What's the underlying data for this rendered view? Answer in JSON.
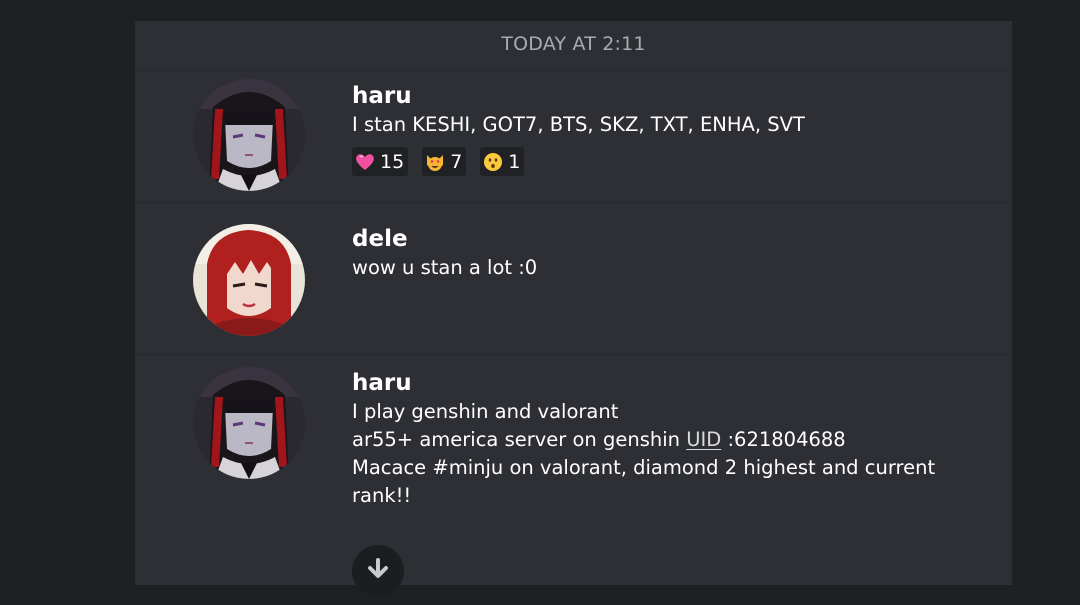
{
  "timestamp": "TODAY AT 2:11",
  "messages": [
    {
      "username": "haru",
      "lines": [
        "I stan KESHI, GOT7, BTS, SKZ, TXT, ENHA, SVT"
      ],
      "reactions": [
        {
          "icon": "pink-heart-icon",
          "count": "15"
        },
        {
          "icon": "heart-eyes-cat-icon",
          "count": "7"
        },
        {
          "icon": "kissing-face-icon",
          "count": "1"
        }
      ]
    },
    {
      "username": "dele",
      "lines": [
        "wow u stan a lot :0"
      ]
    },
    {
      "username": "haru",
      "lines": [
        "I play genshin and valorant",
        "ar55+ america server on genshin ",
        "Macace #minju on valorant, diamond 2 highest and current",
        "rank!!"
      ],
      "uid_label": "UID",
      "uid_value": " :621804688"
    }
  ],
  "scroll_down_icon": "arrow-down-icon",
  "colors": {
    "background": "#1f2023",
    "panel": "#2e2f34",
    "timestamp_text": "#a9abb0",
    "reaction_bg": "#202125"
  }
}
